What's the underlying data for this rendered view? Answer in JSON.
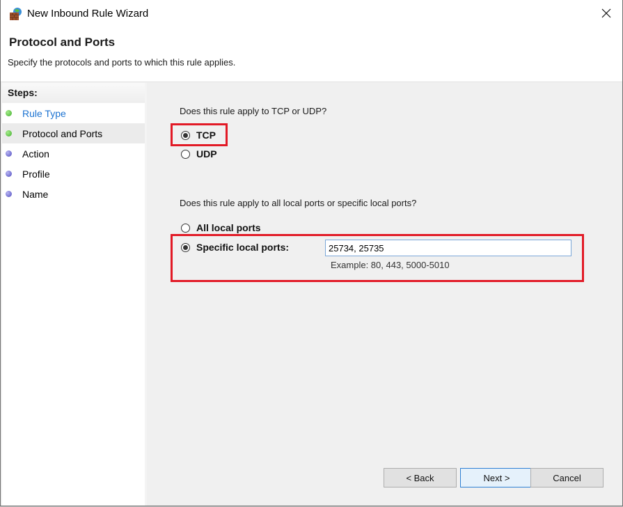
{
  "window": {
    "title": "New Inbound Rule Wizard",
    "icon": "firewall-icon",
    "close_icon": "close-icon"
  },
  "header": {
    "title": "Protocol and Ports",
    "subtitle": "Specify the protocols and ports to which this rule applies."
  },
  "steps": {
    "heading": "Steps:",
    "items": [
      {
        "label": "Rule Type",
        "state": "done",
        "link": true
      },
      {
        "label": "Protocol and Ports",
        "state": "current",
        "link": false
      },
      {
        "label": "Action",
        "state": "pending",
        "link": false
      },
      {
        "label": "Profile",
        "state": "pending",
        "link": false
      },
      {
        "label": "Name",
        "state": "pending",
        "link": false
      }
    ]
  },
  "protocol": {
    "question": "Does this rule apply to TCP or UDP?",
    "options": [
      {
        "label": "TCP",
        "checked": true
      },
      {
        "label": "UDP",
        "checked": false
      }
    ]
  },
  "ports": {
    "question": "Does this rule apply to all local ports or specific local ports?",
    "options": [
      {
        "label": "All local ports",
        "checked": false
      },
      {
        "label": "Specific local ports:",
        "checked": true
      }
    ],
    "input_value": "25734, 25735",
    "example": "Example: 80, 443, 5000-5010"
  },
  "buttons": {
    "back": "< Back",
    "next": "Next >",
    "cancel": "Cancel"
  },
  "colors": {
    "highlight": "#e21a26",
    "link": "#1c73d1",
    "step_done": "#3fae2a",
    "step_pending": "#4f4bbf"
  }
}
